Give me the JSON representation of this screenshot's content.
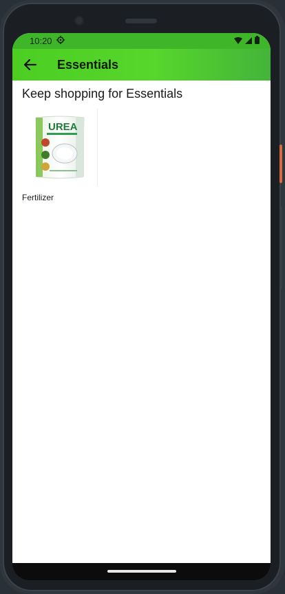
{
  "status_bar": {
    "time": "10:20",
    "settings_icon": "gear-icon",
    "wifi_icon": "wifi-icon",
    "signal_icon": "signal-icon",
    "battery_icon": "battery-icon"
  },
  "app_bar": {
    "back_icon": "arrow-left-icon",
    "title": "Essentials",
    "color": "#4cce22"
  },
  "content": {
    "section_title": "Keep shopping for Essentials",
    "products": [
      {
        "name": "Fertilizer",
        "image_text": "UREA"
      }
    ]
  }
}
